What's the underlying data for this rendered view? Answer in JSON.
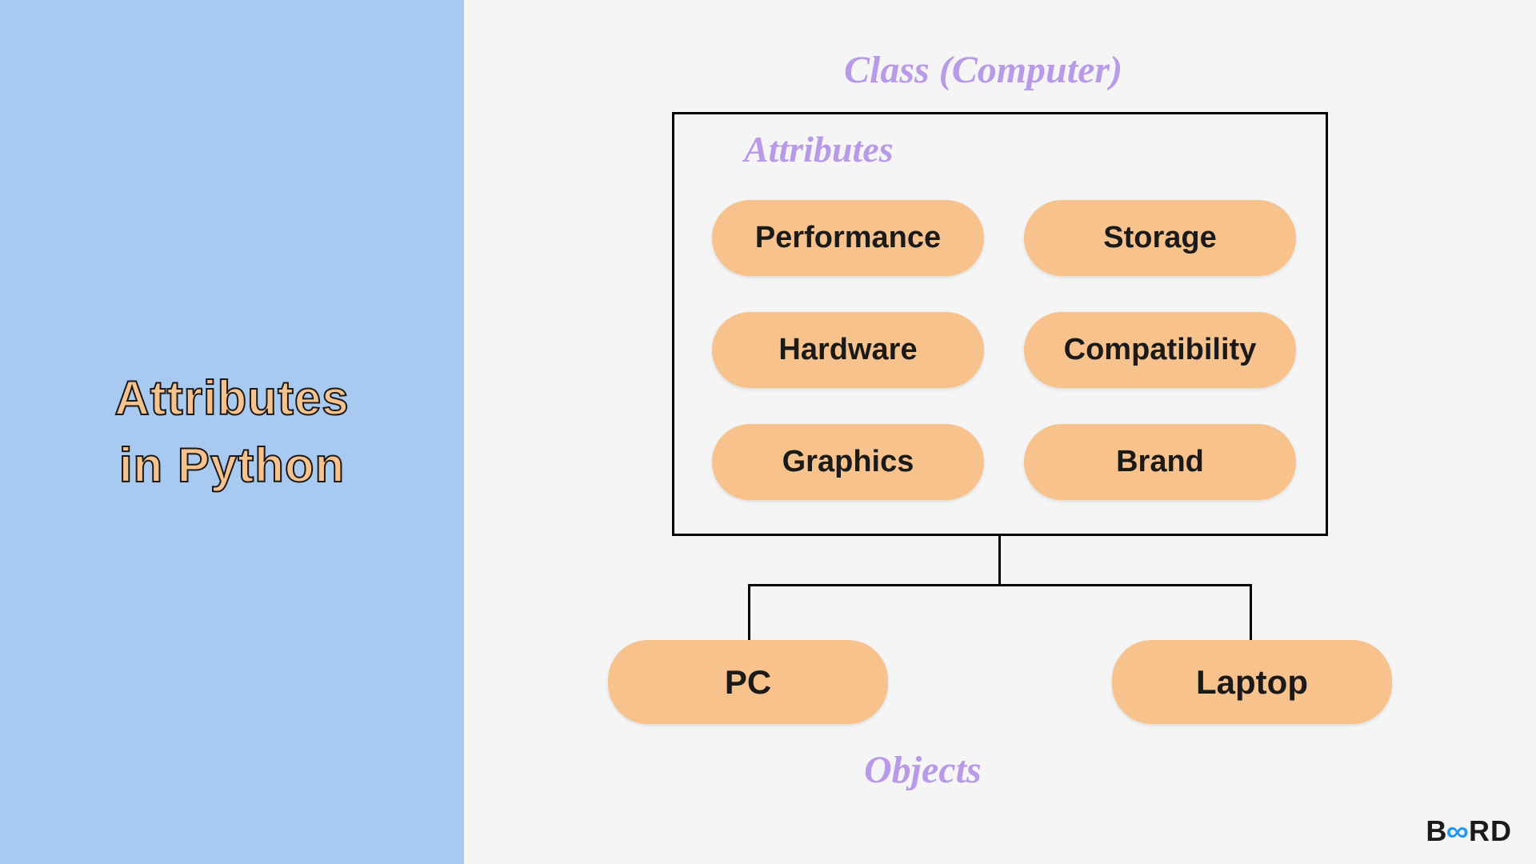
{
  "title": {
    "line1": "Attributes",
    "line2": "in Python"
  },
  "diagram": {
    "class_label": "Class (Computer)",
    "attributes_label": "Attributes",
    "objects_label": "Objects",
    "attributes": {
      "performance": "Performance",
      "storage": "Storage",
      "hardware": "Hardware",
      "compatibility": "Compatibility",
      "graphics": "Graphics",
      "brand": "Brand"
    },
    "objects": {
      "pc": "PC",
      "laptop": "Laptop"
    }
  },
  "logo": {
    "part1": "B",
    "infinity": "∞",
    "part2": "RD"
  }
}
